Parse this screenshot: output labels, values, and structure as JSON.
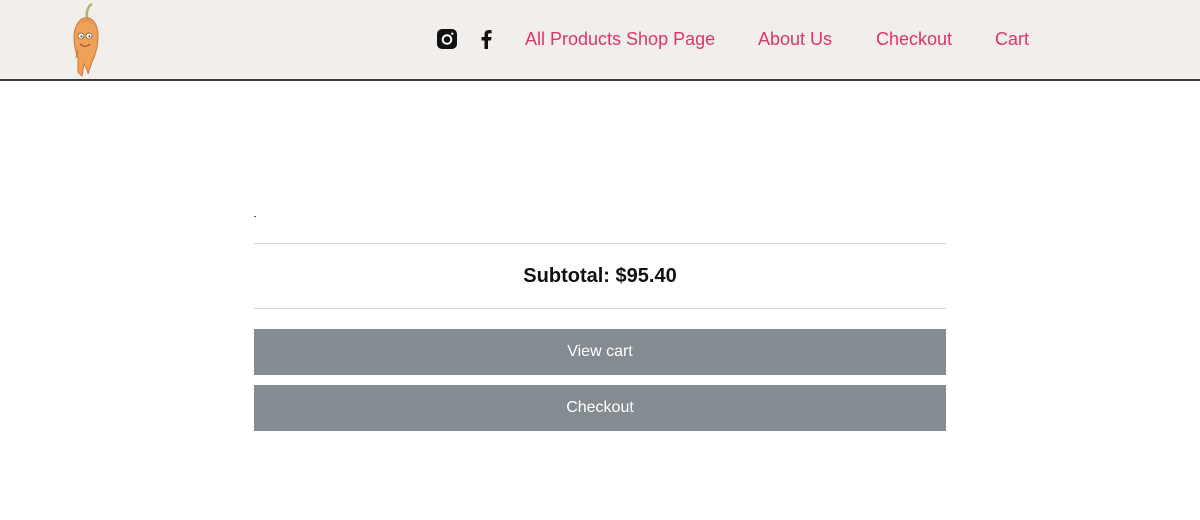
{
  "header": {
    "logo_icon": "chili-pepper-mascot-icon",
    "social": [
      {
        "icon": "instagram-icon"
      },
      {
        "icon": "facebook-icon"
      }
    ],
    "nav": {
      "all_products": "All Products Shop Page",
      "about": "About Us",
      "checkout": "Checkout",
      "cart": "Cart"
    },
    "colors": {
      "background": "#f2eeeb",
      "link": "#e0336a"
    }
  },
  "cart": {
    "subtotal_label": "Subtotal:",
    "subtotal_amount": "$95.40",
    "view_cart_label": "View cart",
    "checkout_label": "Checkout",
    "button_color": "#848b91"
  }
}
